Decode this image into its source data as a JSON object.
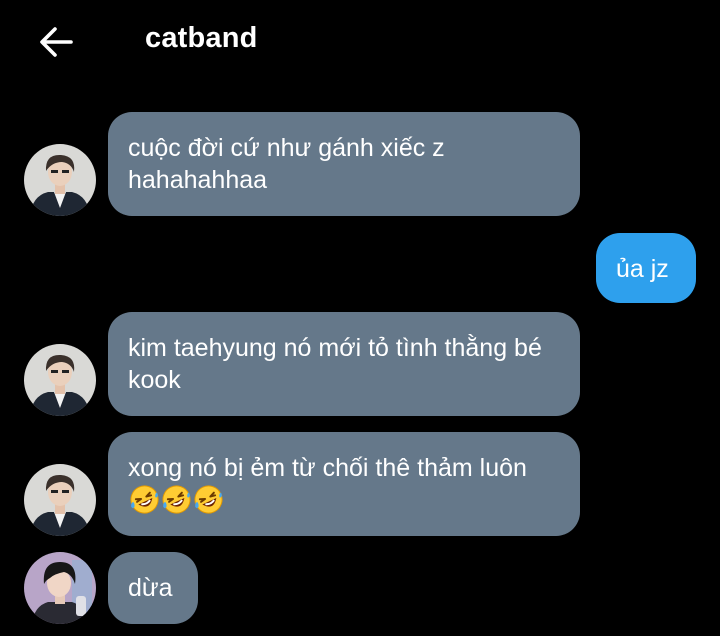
{
  "header": {
    "title": "catband",
    "back_icon": "arrow-left-icon"
  },
  "messages": [
    {
      "sender": "other",
      "avatar": "avatar-boy",
      "text": "cuộc đời cứ như gánh xiếc z hahahahhaa"
    },
    {
      "sender": "me",
      "text": "ủa jz"
    },
    {
      "sender": "other",
      "avatar": "avatar-boy",
      "text": "kim taehyung nó mới tỏ tình thằng bé kook"
    },
    {
      "sender": "other",
      "avatar": "avatar-boy",
      "text": "xong nó bị ẻm từ chối thê thảm luôn",
      "emojis": [
        "rofl-emoji",
        "rofl-emoji",
        "rofl-emoji"
      ]
    },
    {
      "sender": "other",
      "avatar": "avatar-idol",
      "text": "dừa"
    }
  ],
  "colors": {
    "background": "#000000",
    "incoming_bubble": "#65788a",
    "outgoing_bubble": "#2ea0ed",
    "text": "#ffffff"
  }
}
